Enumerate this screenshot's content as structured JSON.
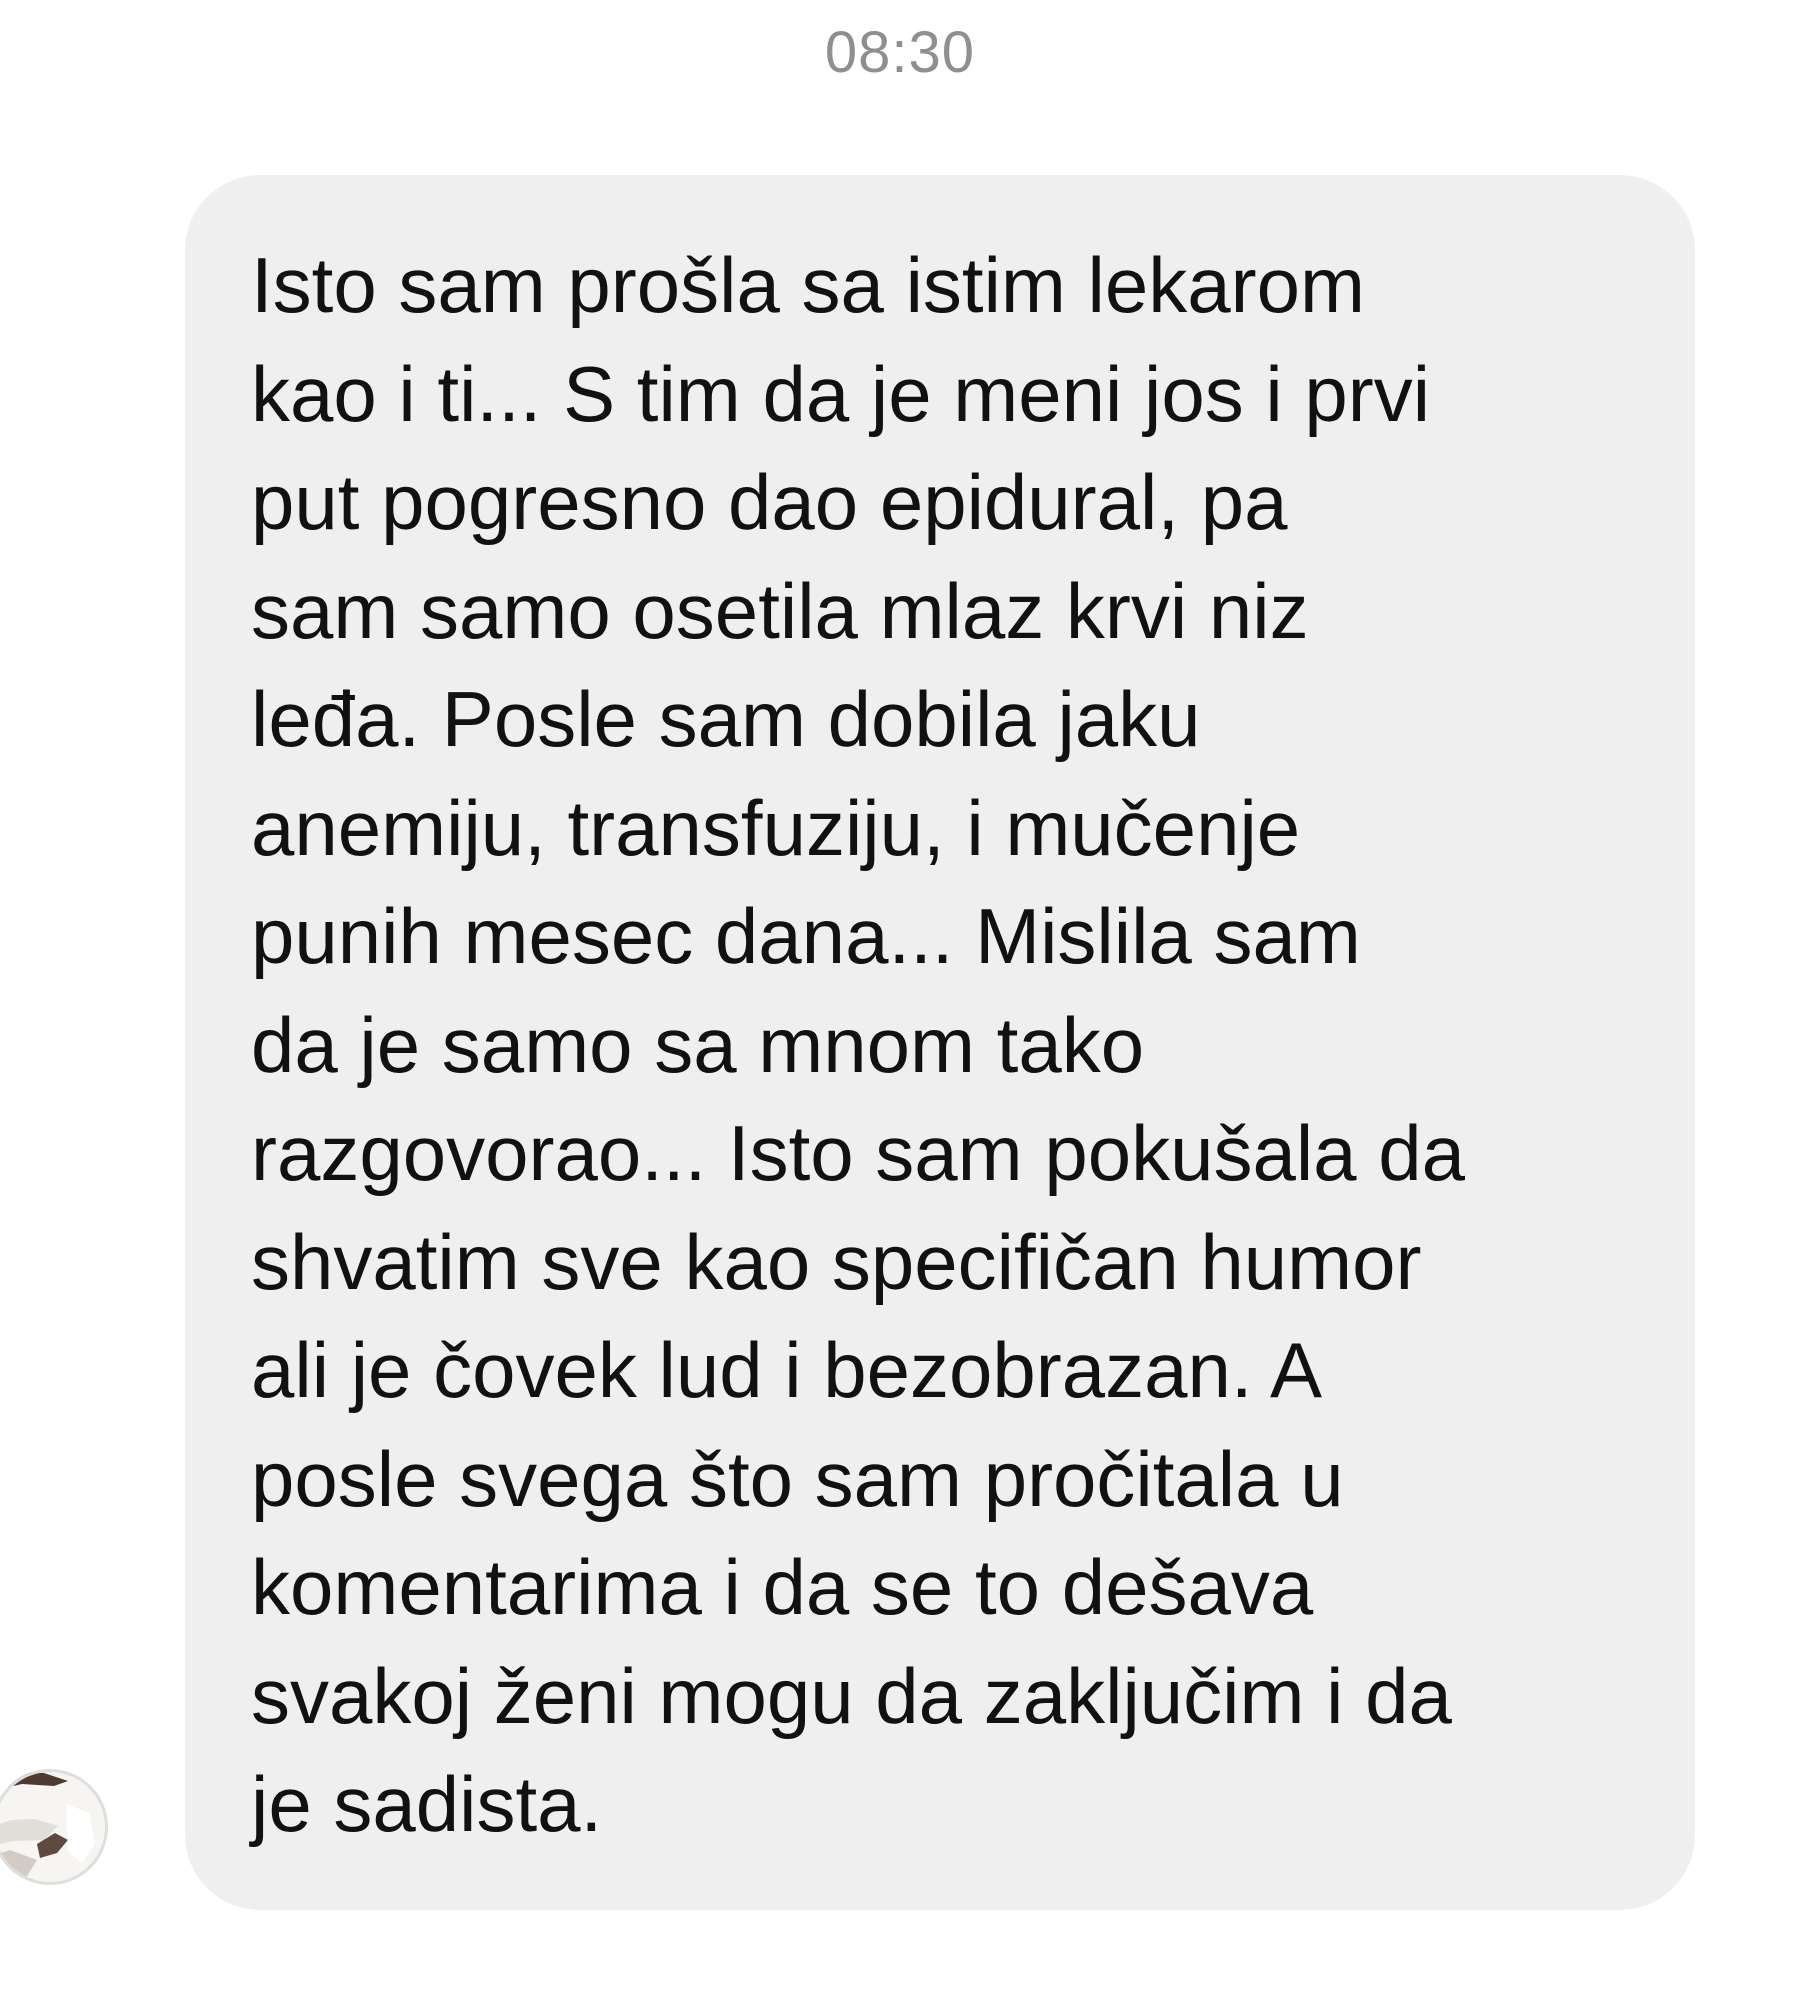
{
  "conversation": {
    "timestamp": "08:30",
    "message": {
      "lines": [
        "Isto sam prošla sa istim lekarom",
        "kao i ti... S tim da je meni jos i prvi",
        "put pogresno dao epidural, pa",
        "sam samo osetila mlaz krvi niz",
        "leđa. Posle sam dobila jaku",
        "anemiju, transfuziju, i mučenje",
        "punih mesec dana... Mislila sam",
        "da je samo sa mnom tako",
        "razgovorao... Isto sam pokušala da",
        "shvatim sve kao specifičan humor",
        "ali je čovek lud i bezobrazan. A",
        "posle svega što sam pročitala u",
        "komentarima i da se to dešava",
        "svakoj ženi mogu da zaključim i da",
        "je sadista."
      ]
    }
  },
  "colors": {
    "background": "#ffffff",
    "bubble": "#efefef",
    "message_text": "#111111",
    "timestamp_text": "#8e8e93"
  }
}
